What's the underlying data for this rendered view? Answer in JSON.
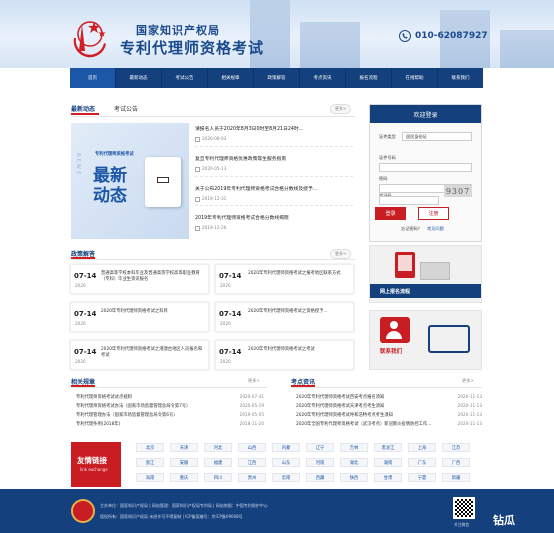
{
  "banner": {
    "agency": "国家知识产权局",
    "exam_title": "专利代理师资格考试",
    "hotline": "010-62087927"
  },
  "nav": {
    "items": [
      "首页",
      "最新动态",
      "考试公告",
      "相关规章",
      "政策解答",
      "考点资讯",
      "报名流程",
      "在线帮助",
      "联系我们"
    ]
  },
  "news": {
    "tab_active": "最新动态",
    "tab_other": "考试公告",
    "more": "更多>",
    "image_caption_top": "专利代理师资格考试",
    "image_caption_big1": "最新",
    "image_caption_big2": "动态",
    "image_side": "NEWS",
    "items": [
      {
        "title": "请报名人员于2020年8月3日0时至8月21日24时...",
        "date": "2020-08-03"
      },
      {
        "title": "复旦专利代理师资格优惠政策等生服务指南",
        "date": "2020-05-13"
      },
      {
        "title": "关于公布2019年专利代理师资格考试合格分数线及授予...",
        "date": "2019-12-31"
      },
      {
        "title": "2019年专利代理师资格考试合格分数线揭晓",
        "date": "2019-12-26"
      }
    ]
  },
  "policy": {
    "heading": "政策解答",
    "more": "更多>",
    "items": [
      {
        "date": "07-14",
        "year": "2020",
        "text": "普通高等学校本科毕业及普通高等学校高等职业教育（专科）毕业生资讯报名"
      },
      {
        "date": "07-14",
        "year": "2020",
        "text": "2020年专利代理师资格考试之报考地区联系方式"
      },
      {
        "date": "07-14",
        "year": "2020",
        "text": "2020年专利代理师资格考试之科目"
      },
      {
        "date": "07-14",
        "year": "2020",
        "text": "2020年专利代理师资格考试之资格授予..."
      },
      {
        "date": "07-14",
        "year": "2020",
        "text": "2020年专利代理师资格考试之港澳台地区人员报名和考试"
      },
      {
        "date": "07-14",
        "year": "2020",
        "text": "2020年专利代理师资格考试之考试"
      }
    ]
  },
  "login": {
    "title": "欢迎登录",
    "id_type_label": "证件类型",
    "id_type_value": "居民身份证",
    "id_number_label": "证件号码",
    "password_label": "密码",
    "captcha_label": "验证码",
    "captcha_value": "9307",
    "login_button": "登录",
    "register_button": "注册",
    "forgot_link": "忘记密码？",
    "faq_link": "常见问题"
  },
  "side_cards": {
    "signup": "网上报名流程",
    "contact": "联系我们"
  },
  "rules": {
    "heading": "相关规章",
    "more": "更多>",
    "items": [
      {
        "title": "专利代理师资格考试试点规则",
        "date": "2020-07-31"
      },
      {
        "title": "专利代理师资格考试办法（国家市场监督管理总局令第7号）",
        "date": "2020-05-19"
      },
      {
        "title": "专利代理管理办法（国家市场监督管理总局令第6号）",
        "date": "2019-05-05"
      },
      {
        "title": "专利代理条例(2018年)",
        "date": "2018-11-20"
      }
    ]
  },
  "exam_news": {
    "heading": "考点资讯",
    "more": "更多>",
    "items": [
      {
        "title": "2020年专利代理师资格考试西安考点报名须知",
        "date": "2020-11-13"
      },
      {
        "title": "2020年专利代理师资格考试天津考点考生须知",
        "date": "2020-11-13"
      },
      {
        "title": "2020年专利代理师资格考试呼和浩特考点考生须知",
        "date": "2020-11-13"
      },
      {
        "title": "2020年全国专利代理师资格考试（武汉考点）新冠肺炎疫情防控工作...",
        "date": "2020-11-13"
      }
    ]
  },
  "links": {
    "title": "友情链接",
    "subtitle": "link exchange",
    "cities": [
      "北京",
      "天津",
      "河北",
      "山西",
      "内蒙",
      "辽宁",
      "吉林",
      "黑龙江",
      "上海",
      "江苏",
      "浙江",
      "安徽",
      "福建",
      "江西",
      "山东",
      "河南",
      "湖北",
      "湖南",
      "广东",
      "广西",
      "海南",
      "重庆",
      "四川",
      "贵州",
      "云南",
      "西藏",
      "陕西",
      "甘肃",
      "宁夏",
      "新疆"
    ]
  },
  "footer": {
    "line1": "主办单位：国家知识产权局 | 网站管理：国家知识产权局专利局 | 网站地图：中国专利保护中心",
    "line2": "版权所有：国家知识产权局 未经许可不得复制 | ICP备案编号：京ICP备09008号",
    "qr_label": "关注微信",
    "watermark": "钻瓜"
  }
}
